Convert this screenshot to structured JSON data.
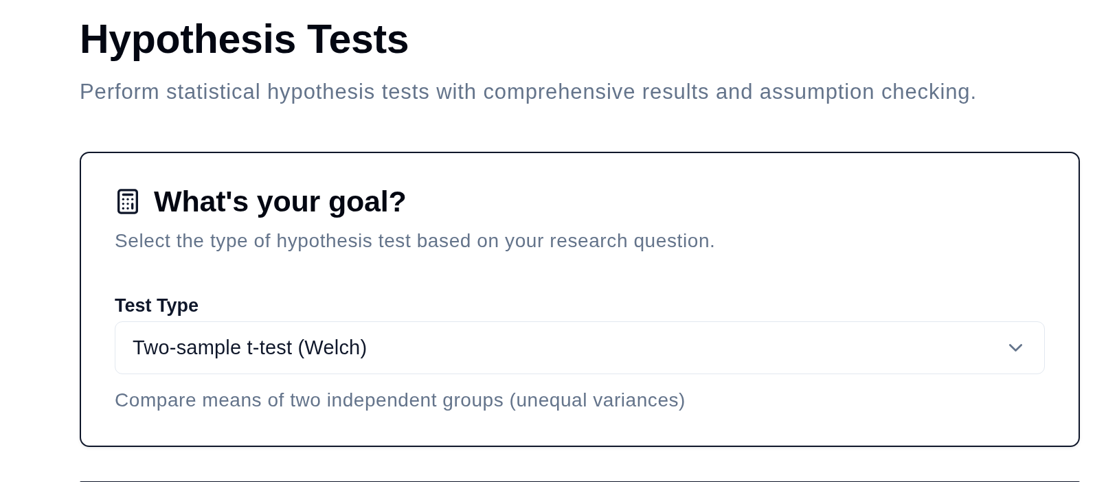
{
  "page": {
    "title": "Hypothesis Tests",
    "subtitle": "Perform statistical hypothesis tests with comprehensive results and assumption checking."
  },
  "goal_card": {
    "title": "What's your goal?",
    "description": "Select the type of hypothesis test based on your research question.",
    "test_type": {
      "label": "Test Type",
      "value": "Two-sample t-test (Welch)",
      "help": "Compare means of two independent groups (unequal variances)"
    }
  }
}
